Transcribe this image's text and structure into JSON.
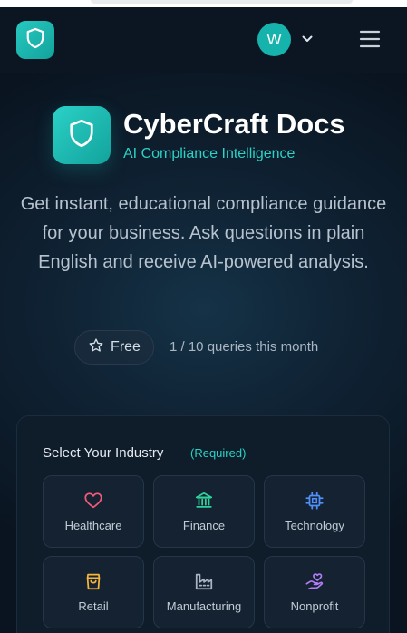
{
  "header": {
    "avatar_initial": "W",
    "icons": {
      "logo": "shield-icon",
      "account_dropdown": "chevron-down-icon",
      "menu": "hamburger-menu-icon"
    }
  },
  "hero": {
    "title": "CyberCraft Docs",
    "subtitle": "AI Compliance Intelligence",
    "description": "Get instant, educational compliance guidance for your business. Ask questions in plain English and receive AI-powered analysis.",
    "plan_label": "Free",
    "plan_icon": "star-icon",
    "usage_text": "1 / 10 queries this month"
  },
  "industry_selector": {
    "title": "Select Your Industry",
    "required_label": "(Required)",
    "options": [
      {
        "label": "Healthcare",
        "icon": "heart-icon",
        "color": "#f25a7a"
      },
      {
        "label": "Finance",
        "icon": "bank-icon",
        "color": "#2fd39a"
      },
      {
        "label": "Technology",
        "icon": "cpu-chip-icon",
        "color": "#4f8ff7"
      },
      {
        "label": "Retail",
        "icon": "shopping-bag-icon",
        "color": "#f5b63a"
      },
      {
        "label": "Manufacturing",
        "icon": "factory-icon",
        "color": "#aab4c2"
      },
      {
        "label": "Nonprofit",
        "icon": "hand-heart-icon",
        "color": "#b27cf5"
      }
    ]
  },
  "colors": {
    "accent": "#16b3ac",
    "accent_text": "#2ad3c4",
    "background": "#0a1420"
  }
}
